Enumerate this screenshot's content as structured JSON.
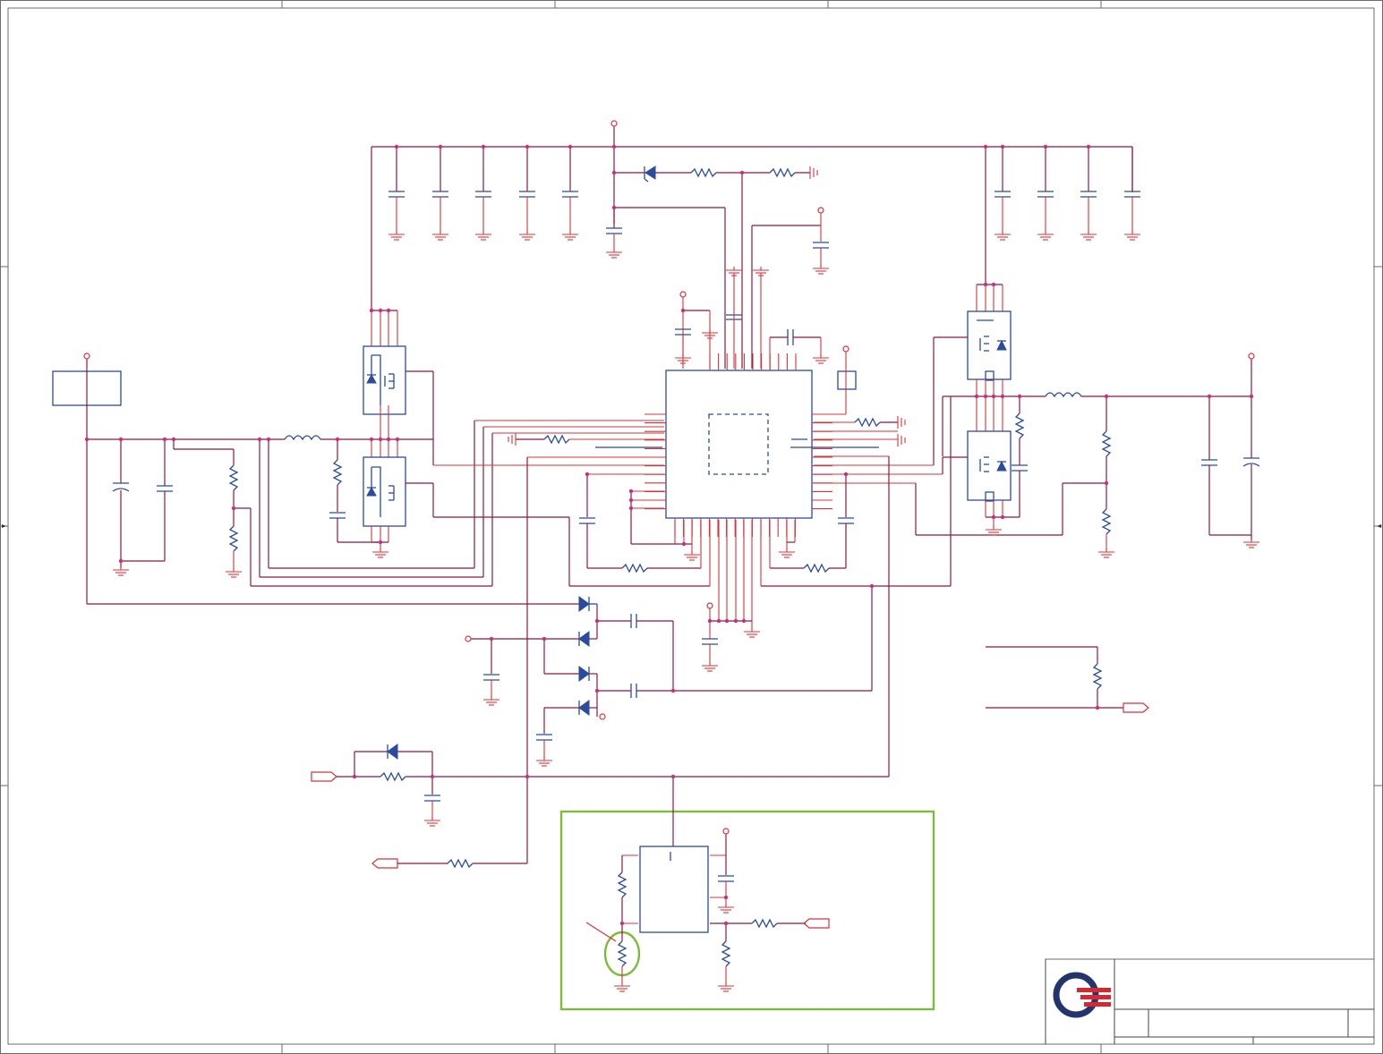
{
  "schematic": {
    "title_block": {
      "logo": "quanta-logo-icon",
      "title": "",
      "size": "",
      "doc_number": "",
      "rev": ""
    },
    "colors": {
      "wire": "#8b1a3c",
      "component_pin": "#d4343a",
      "symbol": "#2b4c9c",
      "highlight": "#7dbb3d",
      "frame": "#6b6b6b"
    },
    "annotations": {
      "highlight_box": "green-rect-around-sub-circuit",
      "highlight_circle": "green-circle-on-pulldown-resistor"
    }
  }
}
